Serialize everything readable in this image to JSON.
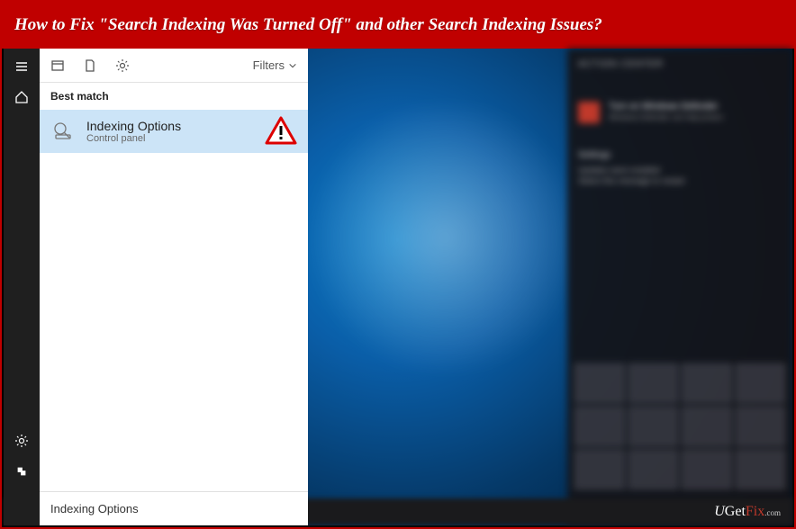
{
  "banner": {
    "title": "How to Fix \"Search Indexing Was Turned Off\" and other Search Indexing Issues?"
  },
  "search_panel": {
    "filters_label": "Filters",
    "section_header": "Best match",
    "result": {
      "title": "Indexing Options",
      "subtitle": "Control panel"
    },
    "search_input_value": "Indexing Options"
  },
  "action_center": {
    "title": "ACTION CENTER",
    "notification": {
      "line1": "Turn on Windows Defender",
      "line2": "Windows Defender can help protect"
    },
    "settings": {
      "heading": "Settings",
      "text1": "Updates were installed",
      "text2": "Select this message to restart"
    }
  },
  "watermark": {
    "u": "U",
    "get": "Get",
    "fix": "Fix",
    "com": ".com"
  }
}
